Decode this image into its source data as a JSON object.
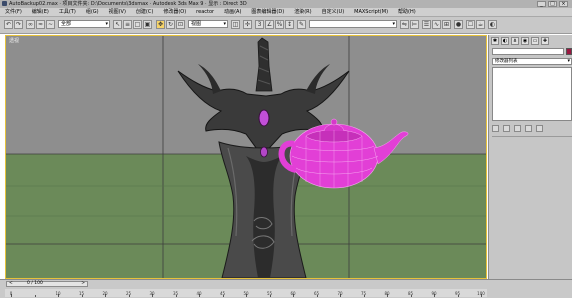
{
  "titlebar": {
    "title": "AutoBackup02.max    · 项目文件夹: D:\\Documents\\3dsmax    · Autodesk 3ds Max 9    · 显示 : Direct 3D",
    "minimize": "_",
    "maximize": "□",
    "close": "×"
  },
  "menubar": {
    "items": [
      "文件(F)",
      "编辑(E)",
      "工具(T)",
      "组(G)",
      "视图(V)",
      "创建(C)",
      "修改器(O)",
      "reactor",
      "动画(A)",
      "图表编辑器(D)",
      "渲染(R)",
      "自定义(U)",
      "MAXScript(M)",
      "帮助(H)"
    ]
  },
  "toolbar": {
    "selection_filter": "全部",
    "view_dropdown": "视图",
    "named_selection": ""
  },
  "viewport": {
    "label": "透视",
    "colors": {
      "background_top": "#8e8e8e",
      "ground": "#6b8a59",
      "teapot": "#e23fd6",
      "active_border": "#e6c23b"
    }
  },
  "command_panel": {
    "modifier_list": "修改器列表",
    "object_color": "#9a1740"
  },
  "timeline": {
    "frame_current": "0",
    "frame_total": "100",
    "frame_slider": "0 / 100",
    "ruler_labels": [
      "0",
      "10",
      "15",
      "20",
      "25",
      "30",
      "35",
      "40",
      "45",
      "50",
      "55",
      "60",
      "65",
      "70",
      "75",
      "80",
      "85",
      "90",
      "95",
      "100"
    ]
  }
}
